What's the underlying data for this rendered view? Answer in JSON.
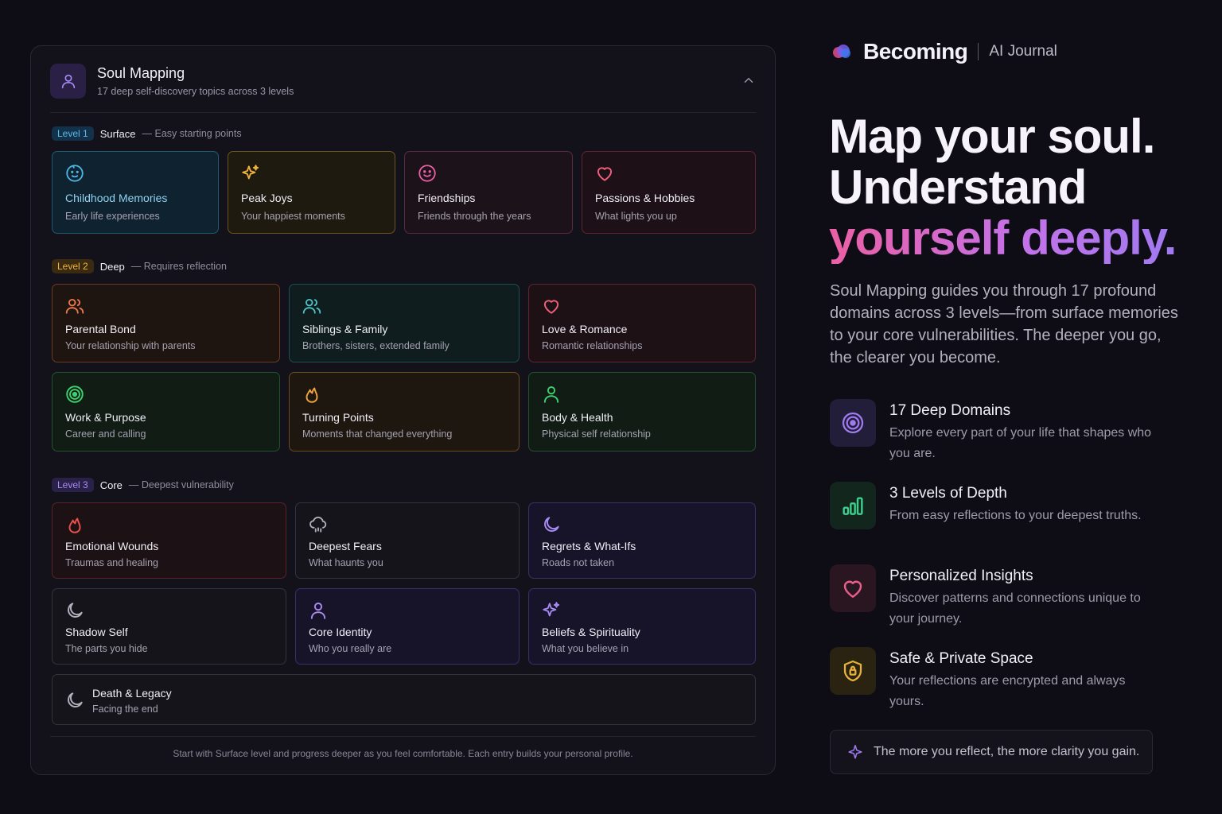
{
  "panel": {
    "title": "Soul Mapping",
    "subtitle": "17 deep self-discovery topics across 3 levels",
    "footer": "Start with Surface level and progress deeper as you feel comfortable. Each entry builds your personal profile."
  },
  "levels": [
    {
      "pill": "Level 1",
      "name": "Surface",
      "desc": "— Easy starting points",
      "color": "#4aa9d6"
    },
    {
      "pill": "Level 2",
      "name": "Deep",
      "desc": "— Requires reflection",
      "color": "#e8a94a"
    },
    {
      "pill": "Level 3",
      "name": "Core",
      "desc": "— Deepest vulnerability",
      "color": "#9a7ff0"
    }
  ],
  "cards": [
    {
      "title": "Childhood Memories",
      "sub": "Early life experiences",
      "icon": "baby-face-icon"
    },
    {
      "title": "Peak Joys",
      "sub": "Your happiest moments",
      "icon": "sparkles-icon"
    },
    {
      "title": "Friendships",
      "sub": "Friends through the years",
      "icon": "smile-icon"
    },
    {
      "title": "Passions & Hobbies",
      "sub": "What lights you up",
      "icon": "heart-icon"
    },
    {
      "title": "Parental Bond",
      "sub": "Your relationship with parents",
      "icon": "users-icon"
    },
    {
      "title": "Siblings & Family",
      "sub": "Brothers, sisters, extended family",
      "icon": "users-icon"
    },
    {
      "title": "Love & Romance",
      "sub": "Romantic relationships",
      "icon": "heart-icon"
    },
    {
      "title": "Work & Purpose",
      "sub": "Career and calling",
      "icon": "target-icon"
    },
    {
      "title": "Turning Points",
      "sub": "Moments that changed everything",
      "icon": "flame-icon"
    },
    {
      "title": "Body & Health",
      "sub": "Physical self relationship",
      "icon": "user-icon"
    },
    {
      "title": "Emotional Wounds",
      "sub": "Traumas and healing",
      "icon": "flame-icon"
    },
    {
      "title": "Deepest Fears",
      "sub": "What haunts you",
      "icon": "cloud-rain-icon"
    },
    {
      "title": "Regrets & What-Ifs",
      "sub": "Roads not taken",
      "icon": "moon-icon"
    },
    {
      "title": "Shadow Self",
      "sub": "The parts you hide",
      "icon": "moon-icon"
    },
    {
      "title": "Core Identity",
      "sub": "Who you really are",
      "icon": "user-icon"
    },
    {
      "title": "Beliefs & Spirituality",
      "sub": "What you believe in",
      "icon": "sparkles-icon"
    },
    {
      "title": "Death & Legacy",
      "sub": "Facing the end",
      "icon": "moon-icon"
    }
  ],
  "brand": {
    "name": "Becoming",
    "tag": "AI Journal"
  },
  "hero": {
    "line1": "Map your soul.",
    "line2": "Understand",
    "line3": "yourself deeply."
  },
  "lead": "Soul Mapping guides you through 17 profound domains across 3 levels—from surface memories to your core vulnerabilities. The deeper you go, the clearer you become.",
  "features": [
    {
      "title": "17 Deep Domains",
      "desc": "Explore every part of your life that shapes who you are.",
      "icon": "target-icon",
      "color": "#a07af0"
    },
    {
      "title": "3 Levels of Depth",
      "desc": "From easy reflections to your deepest truths.",
      "icon": "bar-chart-icon",
      "color": "#3ecf8e"
    },
    {
      "title": "Personalized Insights",
      "desc": "Discover patterns and connections unique to your journey.",
      "icon": "heart-icon",
      "color": "#ec5f8a"
    },
    {
      "title": "Safe & Private Space",
      "desc": "Your reflections are encrypted and always yours.",
      "icon": "shield-lock-icon",
      "color": "#e8b23a"
    }
  ],
  "quote": "The more you reflect, the more clarity you gain."
}
